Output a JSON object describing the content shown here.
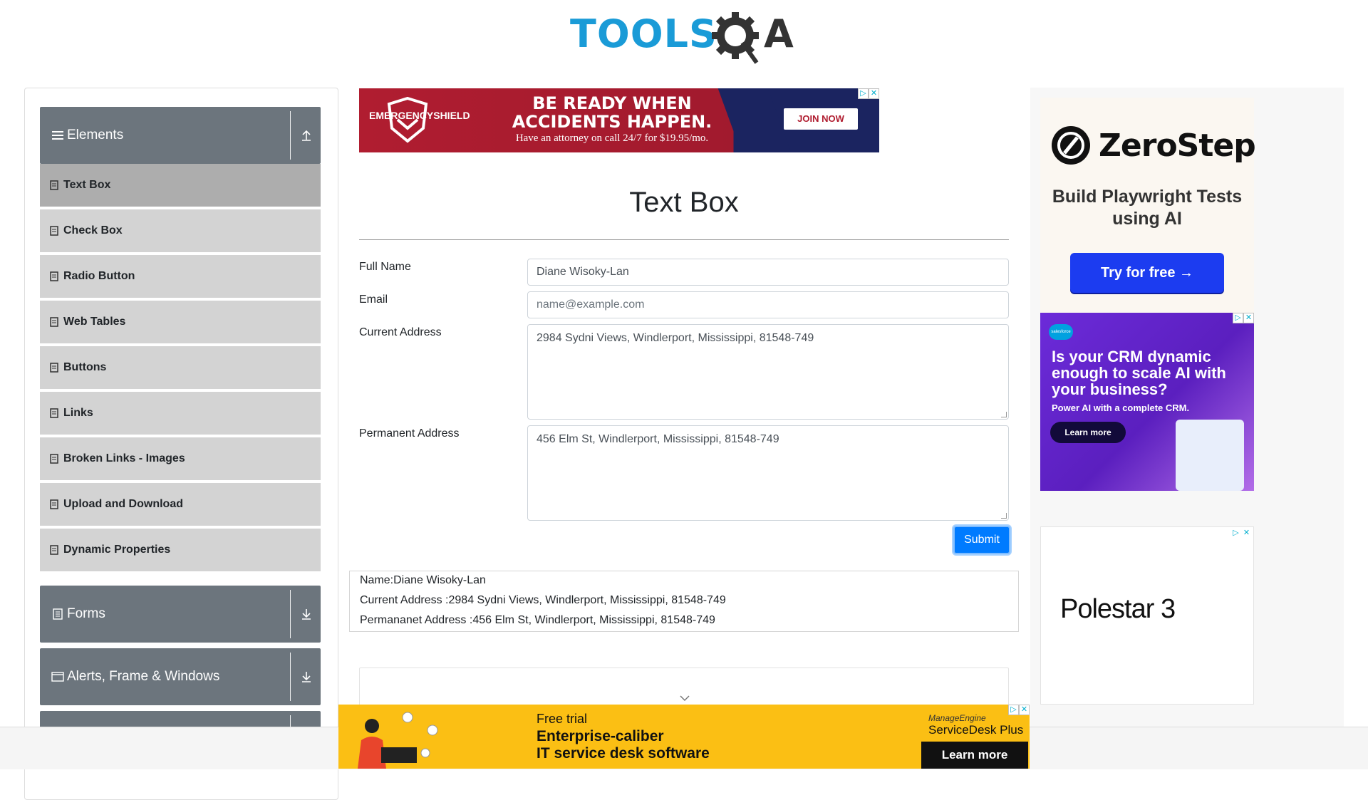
{
  "brand": {
    "logo_left": "TOOLS",
    "logo_right": "A"
  },
  "sidebar": {
    "groups": [
      {
        "title": "Elements",
        "icon": "hamburger-icon",
        "arrow": "collapse-up-icon"
      },
      {
        "title": "Forms",
        "icon": "document-icon",
        "arrow": "expand-down-icon"
      },
      {
        "title": "Alerts, Frame & Windows",
        "icon": "window-icon",
        "arrow": "expand-down-icon"
      }
    ],
    "items": [
      {
        "label": "Text Box",
        "active": true
      },
      {
        "label": "Check Box"
      },
      {
        "label": "Radio Button"
      },
      {
        "label": "Web Tables"
      },
      {
        "label": "Buttons"
      },
      {
        "label": "Links"
      },
      {
        "label": "Broken Links - Images"
      },
      {
        "label": "Upload and Download"
      },
      {
        "label": "Dynamic Properties"
      }
    ]
  },
  "top_ad": {
    "brand": "EMERGENCYSHIELD",
    "headline": "BE READY WHEN ACCIDENTS HAPPEN.",
    "sub": "Have an attorney on call 24/7 for $19.95/mo.",
    "cta": "JOIN NOW"
  },
  "form": {
    "title": "Text Box",
    "full_name_label": "Full Name",
    "full_name_value": "Diane Wisoky-Lan",
    "email_label": "Email",
    "email_placeholder": "name@example.com",
    "current_address_label": "Current Address",
    "current_address_value": "2984 Sydni Views, Windlerport, Mississippi, 81548-749",
    "permanent_address_label": "Permanent Address",
    "permanent_address_value": "456 Elm St, Windlerport, Mississippi, 81548-749",
    "submit_label": "Submit"
  },
  "output": {
    "name": "Name:Diane Wisoky-Lan",
    "current_address": "Current Address :2984 Sydni Views, Windlerport, Mississippi, 81548-749",
    "permanent_address": "Permananet Address :456 Elm St, Windlerport, Mississippi, 81548-749"
  },
  "right_ads": {
    "zerostep_name": "ZeroStep",
    "zerostep_tagline": "Build Playwright Tests using AI",
    "zerostep_cta": "Try for free →",
    "salesforce_logo": "salesforce",
    "salesforce_headline": "Is your CRM dynamic enough to scale AI with your business?",
    "salesforce_sub": "Power AI with a complete CRM.",
    "salesforce_cta": "Learn more",
    "polestar_name": "Polestar 3"
  },
  "bottom_ad": {
    "line1": "Free trial",
    "line2": "Enterprise-caliber",
    "line3": "IT service desk software",
    "vendor": "ManageEngine",
    "product": "ServiceDesk Plus",
    "cta": "Learn more"
  },
  "colors": {
    "logo_blue": "#1a9bd7",
    "logo_dark": "#333333",
    "sidebar_header": "#6c757d",
    "sidebar_item": "#d3d3d3",
    "sidebar_active": "#adadad",
    "primary": "#007bff"
  }
}
